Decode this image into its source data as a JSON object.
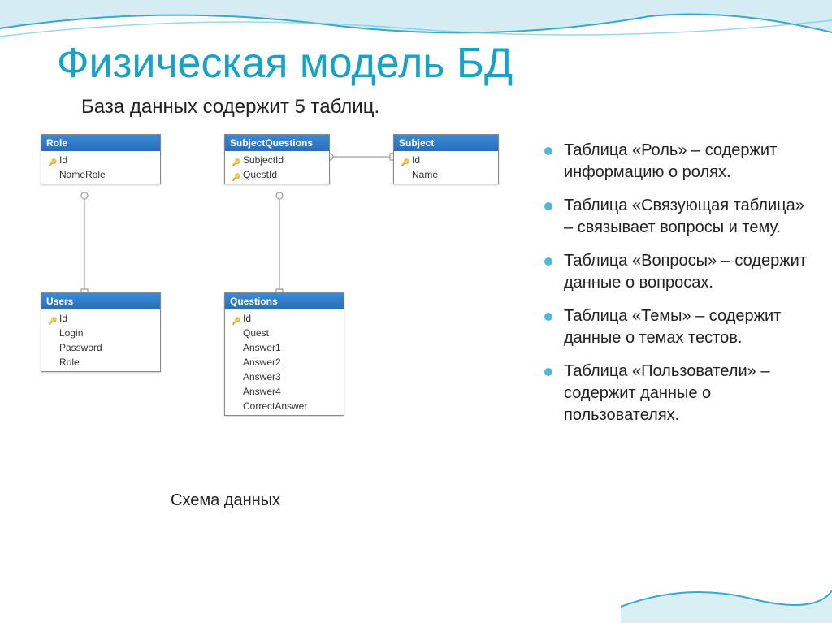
{
  "title": "Физическая модель БД",
  "subtitle": "База данных содержит 5 таблиц.",
  "diagram_caption": "Схема данных",
  "tables": {
    "role": {
      "name": "Role",
      "fields": [
        {
          "label": "Id",
          "pk": true
        },
        {
          "label": "NameRole",
          "pk": false
        }
      ]
    },
    "subjectquestions": {
      "name": "SubjectQuestions",
      "fields": [
        {
          "label": "SubjectId",
          "pk": true
        },
        {
          "label": "QuestId",
          "pk": true
        }
      ]
    },
    "subject": {
      "name": "Subject",
      "fields": [
        {
          "label": "Id",
          "pk": true
        },
        {
          "label": "Name",
          "pk": false
        }
      ]
    },
    "users": {
      "name": "Users",
      "fields": [
        {
          "label": "Id",
          "pk": true
        },
        {
          "label": "Login",
          "pk": false
        },
        {
          "label": "Password",
          "pk": false
        },
        {
          "label": "Role",
          "pk": false
        }
      ]
    },
    "questions": {
      "name": "Questions",
      "fields": [
        {
          "label": "Id",
          "pk": true
        },
        {
          "label": "Quest",
          "pk": false
        },
        {
          "label": "Answer1",
          "pk": false
        },
        {
          "label": "Answer2",
          "pk": false
        },
        {
          "label": "Answer3",
          "pk": false
        },
        {
          "label": "Answer4",
          "pk": false
        },
        {
          "label": "CorrectAnswer",
          "pk": false
        }
      ]
    }
  },
  "bullets": [
    "Таблица «Роль» – содержит информацию о ролях.",
    "Таблица «Связующая таблица» – связывает вопросы и тему.",
    "Таблица «Вопросы» – содержит данные о вопросах.",
    "Таблица «Темы» – содержит данные о темах тестов.",
    "Таблица «Пользователи» – содержит данные о пользователях."
  ]
}
